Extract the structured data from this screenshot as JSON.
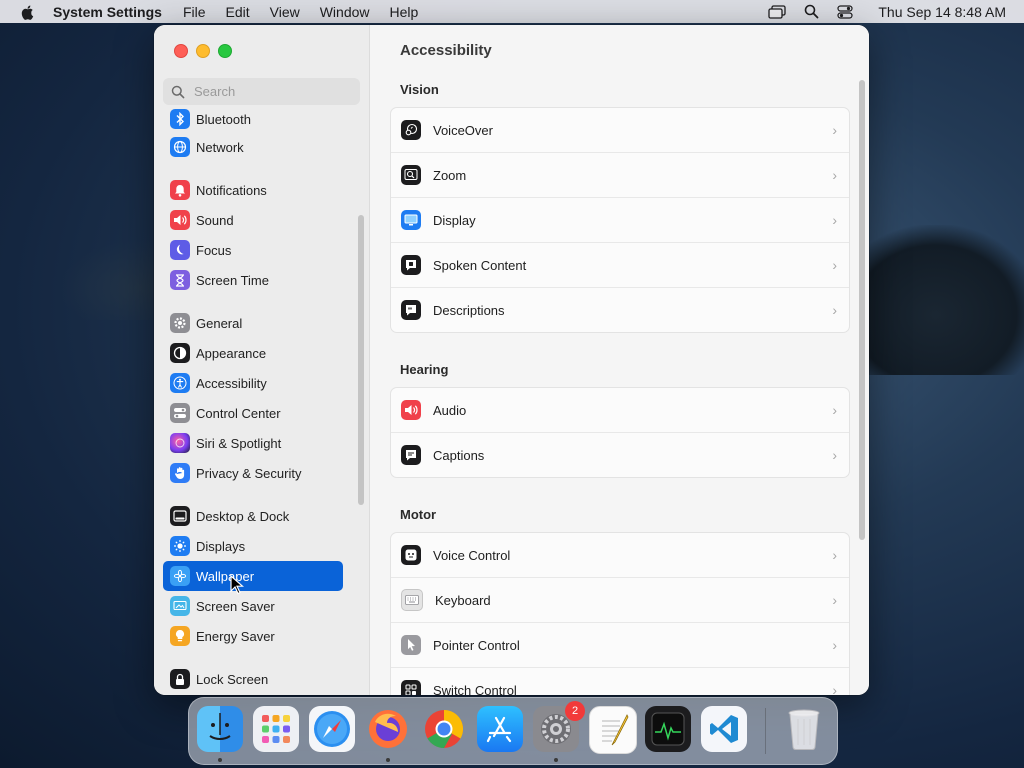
{
  "menubar": {
    "app_name": "System Settings",
    "menus": [
      "File",
      "Edit",
      "View",
      "Window",
      "Help"
    ],
    "clock": "Thu Sep 14  8:48 AM"
  },
  "search": {
    "placeholder": "Search"
  },
  "sidebar": {
    "items": [
      {
        "label": "Bluetooth",
        "icon": "bluetooth-icon",
        "color": "#1e7cf2"
      },
      {
        "label": "Network",
        "icon": "globe-icon",
        "color": "#1e7cf2"
      },
      {
        "label": "Notifications",
        "icon": "bell-icon",
        "color": "#f0414b"
      },
      {
        "label": "Sound",
        "icon": "speaker-icon",
        "color": "#f0414b"
      },
      {
        "label": "Focus",
        "icon": "moon-icon",
        "color": "#5e5ce6"
      },
      {
        "label": "Screen Time",
        "icon": "hourglass-icon",
        "color": "#7d5fe0"
      },
      {
        "label": "General",
        "icon": "gear-icon",
        "color": "#8e8e93"
      },
      {
        "label": "Appearance",
        "icon": "appearance-icon",
        "color": "#1c1c1e"
      },
      {
        "label": "Accessibility",
        "icon": "accessibility-icon",
        "color": "#1e7cf2"
      },
      {
        "label": "Control Center",
        "icon": "toggles-icon",
        "color": "#8e8e93"
      },
      {
        "label": "Siri & Spotlight",
        "icon": "siri-icon",
        "color": "#b445d6"
      },
      {
        "label": "Privacy & Security",
        "icon": "hand-icon",
        "color": "#2f7cf6"
      },
      {
        "label": "Desktop & Dock",
        "icon": "dock-icon",
        "color": "#1c1c1e"
      },
      {
        "label": "Displays",
        "icon": "sun-icon",
        "color": "#1e7cf2"
      },
      {
        "label": "Wallpaper",
        "icon": "flower-icon",
        "color": "#3aa0f5"
      },
      {
        "label": "Screen Saver",
        "icon": "screensaver-icon",
        "color": "#45b6e8"
      },
      {
        "label": "Energy Saver",
        "icon": "bulb-icon",
        "color": "#f5a623"
      },
      {
        "label": "Lock Screen",
        "icon": "lock-icon",
        "color": "#1c1c1e"
      }
    ],
    "selected": "Wallpaper"
  },
  "content": {
    "title": "Accessibility",
    "sections": [
      {
        "title": "Vision",
        "rows": [
          {
            "label": "VoiceOver",
            "icon": "voiceover-icon"
          },
          {
            "label": "Zoom",
            "icon": "zoom-icon"
          },
          {
            "label": "Display",
            "icon": "display-icon"
          },
          {
            "label": "Spoken Content",
            "icon": "spoken-content-icon"
          },
          {
            "label": "Descriptions",
            "icon": "descriptions-icon"
          }
        ]
      },
      {
        "title": "Hearing",
        "rows": [
          {
            "label": "Audio",
            "icon": "audio-icon"
          },
          {
            "label": "Captions",
            "icon": "captions-icon"
          }
        ]
      },
      {
        "title": "Motor",
        "rows": [
          {
            "label": "Voice Control",
            "icon": "voice-control-icon"
          },
          {
            "label": "Keyboard",
            "icon": "keyboard-icon"
          },
          {
            "label": "Pointer Control",
            "icon": "pointer-icon"
          },
          {
            "label": "Switch Control",
            "icon": "switch-control-icon"
          }
        ]
      }
    ],
    "chevron": "›"
  },
  "dock": {
    "apps": [
      "Finder",
      "Launchpad",
      "Safari",
      "Firefox",
      "Chrome",
      "App Store",
      "System Settings",
      "TextEdit",
      "Activity Monitor",
      "VS Code",
      "Trash"
    ],
    "system_settings_badge": "2"
  }
}
